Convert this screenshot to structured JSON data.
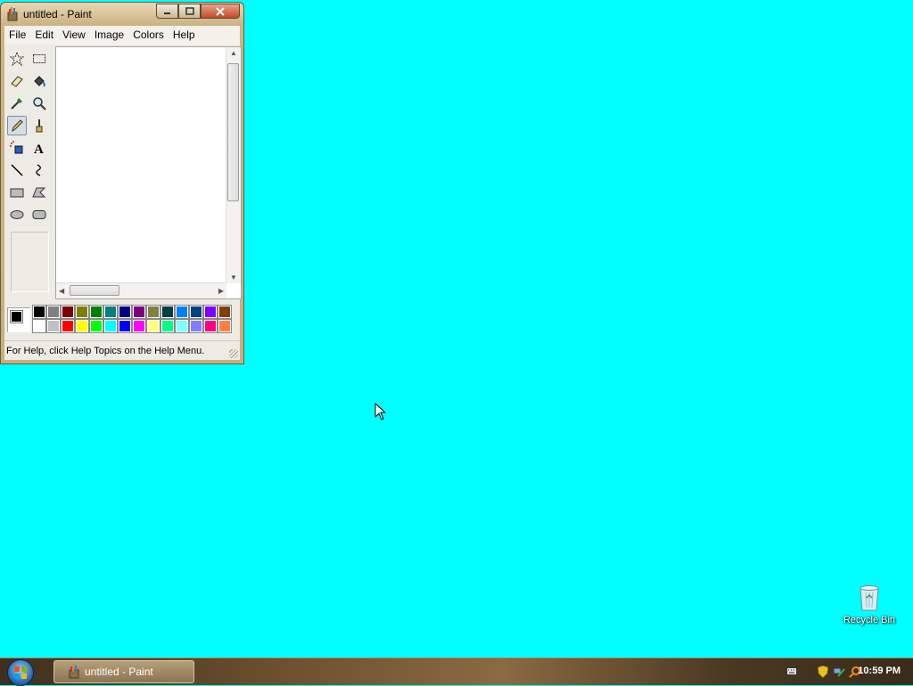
{
  "window": {
    "title": "untitled - Paint",
    "controls": {
      "minimize": "minimize",
      "maximize": "maximize",
      "close": "close"
    }
  },
  "menu": {
    "items": [
      {
        "label": "File"
      },
      {
        "label": "Edit"
      },
      {
        "label": "View"
      },
      {
        "label": "Image"
      },
      {
        "label": "Colors"
      },
      {
        "label": "Help"
      }
    ]
  },
  "tools": [
    {
      "name": "free-form-select",
      "icon": "star-select-icon"
    },
    {
      "name": "select",
      "icon": "rect-select-icon"
    },
    {
      "name": "eraser",
      "icon": "eraser-icon"
    },
    {
      "name": "fill",
      "icon": "paint-bucket-icon"
    },
    {
      "name": "pick-color",
      "icon": "eyedropper-icon"
    },
    {
      "name": "magnifier",
      "icon": "magnifier-icon"
    },
    {
      "name": "pencil",
      "icon": "pencil-icon",
      "selected": true
    },
    {
      "name": "brush",
      "icon": "brush-icon"
    },
    {
      "name": "airbrush",
      "icon": "airbrush-icon"
    },
    {
      "name": "text",
      "icon": "text-icon"
    },
    {
      "name": "line",
      "icon": "line-icon"
    },
    {
      "name": "curve",
      "icon": "curve-icon"
    },
    {
      "name": "rectangle",
      "icon": "rectangle-icon"
    },
    {
      "name": "polygon",
      "icon": "polygon-icon"
    },
    {
      "name": "ellipse",
      "icon": "ellipse-icon"
    },
    {
      "name": "rounded-rectangle",
      "icon": "rounded-rect-icon"
    }
  ],
  "palette": {
    "foreground": "#000000",
    "background": "#ffffff",
    "row1": [
      "#000000",
      "#808080",
      "#800000",
      "#808000",
      "#008000",
      "#008080",
      "#000080",
      "#800080",
      "#808040",
      "#004040",
      "#0080ff",
      "#004080",
      "#8000ff",
      "#804000"
    ],
    "row2": [
      "#ffffff",
      "#c0c0c0",
      "#ff0000",
      "#ffff00",
      "#00ff00",
      "#00ffff",
      "#0000ff",
      "#ff00ff",
      "#ffff80",
      "#00ff80",
      "#80ffff",
      "#8080ff",
      "#ff0080",
      "#ff8040"
    ]
  },
  "status": {
    "text": "For Help, click Help Topics on the Help Menu."
  },
  "desktop": {
    "background": "#00ffff",
    "icons": [
      {
        "label": "Recycle Bin",
        "icon": "recycle-bin-icon"
      }
    ]
  },
  "taskbar": {
    "start": "start-orb-icon",
    "buttons": [
      {
        "label": "untitled - Paint"
      }
    ],
    "clock": "10:59 PM"
  }
}
